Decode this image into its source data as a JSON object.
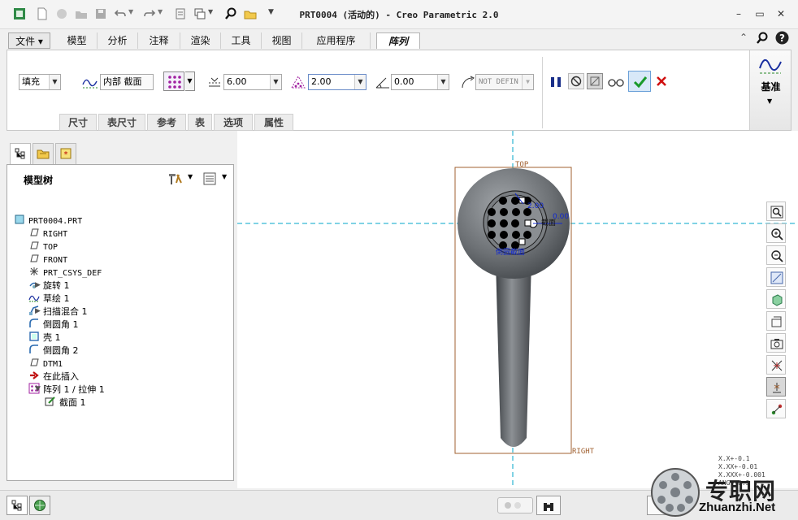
{
  "window": {
    "title": "PRT0004 (活动的) - Creo Parametric 2.0"
  },
  "menu": {
    "tabs": [
      "文件",
      "模型",
      "分析",
      "注释",
      "渲染",
      "工具",
      "视图",
      "应用程序",
      "阵列"
    ],
    "active": "阵列"
  },
  "ribbon": {
    "fill_type": "填充",
    "section_label": "内部 截面",
    "spacing_value": "6.00",
    "border_value": "2.00",
    "rotation_value": "0.00",
    "radius_value": "NOT DEFIN",
    "subtabs": [
      "尺寸",
      "表尺寸",
      "参考",
      "表",
      "选项",
      "属性"
    ],
    "datum_label": "基准"
  },
  "tree": {
    "title": "模型树",
    "items": [
      {
        "label": "PRT0004.PRT",
        "icon": "part-icon",
        "mono": true
      },
      {
        "label": "RIGHT",
        "icon": "datum-plane-icon",
        "mono": true
      },
      {
        "label": "TOP",
        "icon": "datum-plane-icon",
        "mono": true
      },
      {
        "label": "FRONT",
        "icon": "datum-plane-icon",
        "mono": true
      },
      {
        "label": "PRT_CSYS_DEF",
        "icon": "csys-icon",
        "mono": true
      },
      {
        "label": "旋转 1",
        "icon": "revolve-icon",
        "expandable": true
      },
      {
        "label": "草绘 1",
        "icon": "sketch-icon"
      },
      {
        "label": "扫描混合 1",
        "icon": "swept-blend-icon",
        "expandable": true
      },
      {
        "label": "倒圆角 1",
        "icon": "round-icon"
      },
      {
        "label": "壳 1",
        "icon": "shell-icon"
      },
      {
        "label": "倒圆角 2",
        "icon": "round-icon"
      },
      {
        "label": "DTM1",
        "icon": "datum-plane-icon",
        "mono": true
      },
      {
        "label": "在此插入",
        "icon": "insert-here-icon"
      },
      {
        "label": "阵列 1 / 拉伸 1",
        "icon": "pattern-icon",
        "expanded": true
      },
      {
        "label": "截面 1",
        "icon": "section-icon"
      }
    ]
  },
  "viewport": {
    "labels": {
      "top": "TOP",
      "right": "RIGHT",
      "dim_200": "2.00",
      "dim_000": "0.00",
      "section_right": "截面",
      "section_bottom": "倒圆截面"
    }
  },
  "tolerance": {
    "lines": [
      "X.X+-0.1",
      "X.XX+-0.01",
      "X.XXX+-0.001",
      "ANG+-0.5"
    ]
  },
  "watermark": {
    "cn": "专职网",
    "url": "Zhuanzhi.Net"
  },
  "colors": {
    "confirm": "#1a9a2a",
    "cancel": "#d01010",
    "datum": "#a06030",
    "axis": "#00a6c8",
    "dimension": "#1028d0"
  }
}
